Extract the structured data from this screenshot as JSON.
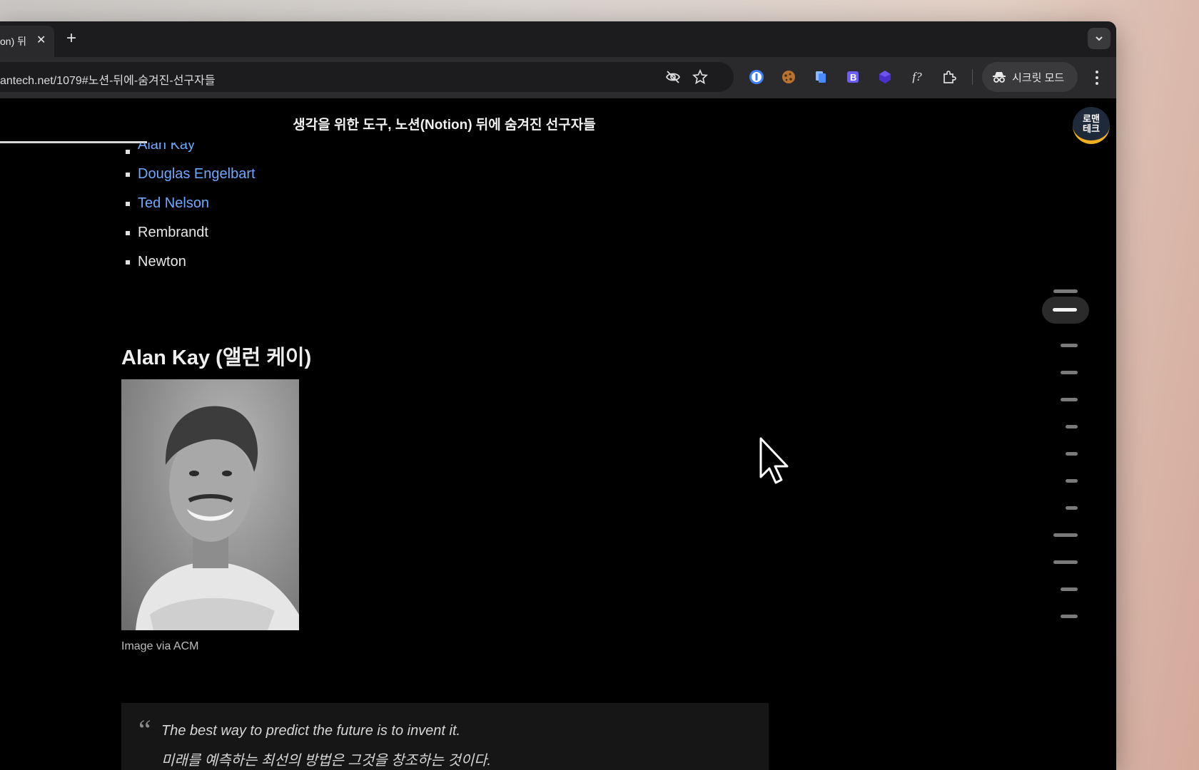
{
  "browser": {
    "tab_title": "on) 뒤",
    "tab_close": "✕",
    "new_tab": "+",
    "url": "antech.net/1079#노션-뒤에-숨겨진-선구자들",
    "incognito_label": "시크릿 모드",
    "extensions": [
      "1password-icon",
      "cookie-icon",
      "copy-icon",
      "bold-icon",
      "gem-icon",
      "function-icon",
      "puzzle-icon"
    ],
    "extension_function_label": "f?"
  },
  "page": {
    "header_title": "생각을 위한 도구, 노션(Notion) 뒤에 숨겨진 선구자들",
    "logo_line1": "로맨",
    "logo_line2": "테크",
    "list_items": [
      {
        "label": "Alan Kay",
        "link": true
      },
      {
        "label": "Douglas Engelbart",
        "link": true
      },
      {
        "label": "Ted Nelson",
        "link": true
      },
      {
        "label": "Rembrandt",
        "link": false
      },
      {
        "label": "Newton",
        "link": false
      }
    ],
    "section_heading": "Alan Kay (앨런 케이)",
    "image_caption": "Image via ACM",
    "quote_mark": "“",
    "quote_en": "The best way to predict the future is to invent it.",
    "quote_ko": "미래를 예측하는 최선의 방법은 그것을 창조하는 것이다."
  },
  "colors": {
    "link": "#6ea8ff",
    "background": "#000000",
    "logo_accent": "#f2b01e"
  }
}
